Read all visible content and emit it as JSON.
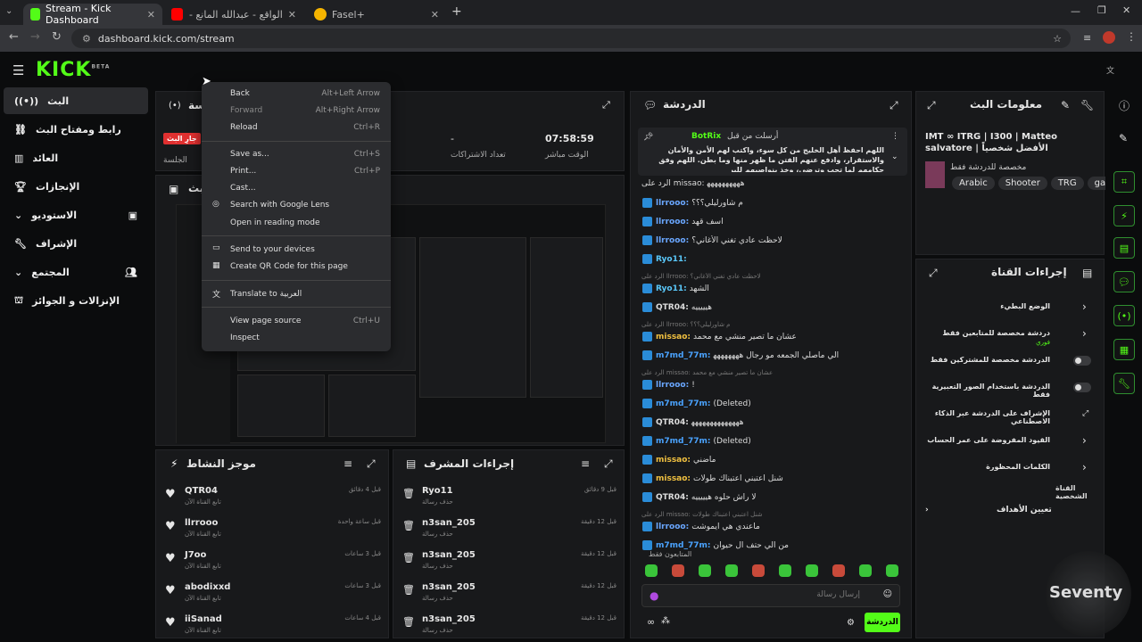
{
  "browser": {
    "tabs": [
      {
        "label": "Stream - Kick Dashboard"
      },
      {
        "label": "الواقع - عبدالله المانع - YouTube"
      },
      {
        "label": "Fasel+"
      }
    ],
    "url": "dashboard.kick.com/stream"
  },
  "sidebar": {
    "items": [
      {
        "label": "البث"
      },
      {
        "label": "رابط ومفتاح البث"
      },
      {
        "label": "العائد"
      },
      {
        "label": "الإنجازات"
      },
      {
        "label": "الاستوديو"
      },
      {
        "label": "الإشراف"
      },
      {
        "label": "المجتمع"
      },
      {
        "label": "الإنزالات و الجوائز"
      }
    ],
    "logo": "KICK",
    "logo_sup": "BETA"
  },
  "session": {
    "title": "الجلسة",
    "live_badge": "جارِ البث",
    "session_label": "الجلسة",
    "subs_value": "-",
    "subs_label": "تعداد الاشتراكات",
    "time_value": "07:58:59",
    "time_label": "الوقت مباشر",
    "preview_title": "بث"
  },
  "context_menu": {
    "items": [
      {
        "label": "Back",
        "key": "Alt+Left Arrow"
      },
      {
        "label": "Forward",
        "key": "Alt+Right Arrow"
      },
      {
        "label": "Reload",
        "key": "Ctrl+R"
      },
      {
        "label": "Save as...",
        "key": "Ctrl+S"
      },
      {
        "label": "Print...",
        "key": "Ctrl+P"
      },
      {
        "label": "Cast...",
        "key": ""
      },
      {
        "label": "Search with Google Lens",
        "key": ""
      },
      {
        "label": "Open in reading mode",
        "key": ""
      },
      {
        "label": "Send to your devices",
        "key": ""
      },
      {
        "label": "Create QR Code for this page",
        "key": ""
      },
      {
        "label": "Translate to العربية",
        "key": ""
      },
      {
        "label": "View page source",
        "key": "Ctrl+U"
      },
      {
        "label": "Inspect",
        "key": ""
      }
    ]
  },
  "chat": {
    "title": "الدردشة",
    "pinned_by": "أرسلت من قبل",
    "pinned_user": "BotRix",
    "pinned_text": "اللهم احفظ أهل الخليج من كل سوء، واكتب لهم الأمن والأمان والاستقرار، وادفع عنهم الفتن ما ظهر منها وما بطن. اللهم وفق حكامهم لما تحب وترضى، وخذ بنواصيهم للبر",
    "messages": [
      {
        "user": "",
        "text": "الرد على missao: ﻫﻬﻬﻬﻬﻬﻬﻬﻬﻬ",
        "reply": ""
      },
      {
        "user": "llrrooo",
        "text": "م شاورليلي؟؟؟",
        "reply": ""
      },
      {
        "user": "llrrooo",
        "text": "اسف قهد",
        "reply": ""
      },
      {
        "user": "llrrooo",
        "text": "لاحظت عادي تغني الأغاني؟",
        "reply": ""
      },
      {
        "user": "Ryo11",
        "text": "",
        "reply": ""
      },
      {
        "user": "Ryo11",
        "text": "الشهد",
        "reply": "الرد على llrrooo: لاحظت عادي تغني الأغاني؟"
      },
      {
        "user": "QTR04",
        "text": "هيييييه",
        "reply": ""
      },
      {
        "user": "missao",
        "text": "عشان ما تصير منشي مع محمد",
        "reply": "الرد على llrrooo: م شاورليلي؟؟؟"
      },
      {
        "user": "m7md_77m",
        "text": "الي ماصلي الجمعه مو رجال ﻫﻬﻬﻬﻬﻬﻬﻬ",
        "reply": ""
      },
      {
        "user": "llrrooo",
        "text": "!",
        "reply": "الرد على missao: عشان ما تصير منشي مع محمد"
      },
      {
        "user": "m7md_77m",
        "text": "(Deleted)",
        "reply": ""
      },
      {
        "user": "QTR04",
        "text": "ﻫﻬﻬﻬﻬﻬﻬﻬﻬﻬﻬﻬﻬﻬ",
        "reply": ""
      },
      {
        "user": "m7md_77m",
        "text": "(Deleted)",
        "reply": ""
      },
      {
        "user": "missao",
        "text": "ماضني",
        "reply": ""
      },
      {
        "user": "missao",
        "text": "شنل اعتبني اعتبناك طولات",
        "reply": ""
      },
      {
        "user": "QTR04",
        "text": "لا راش حلوه هيييييه",
        "reply": ""
      },
      {
        "user": "llrrooo",
        "text": "ماعندي هي ايموشت",
        "reply": "الرد على missao: شنل اعتبني اعتبناك طولات"
      },
      {
        "user": "m7md_77m",
        "text": "من الي حتف ال حيوان",
        "reply": ""
      }
    ],
    "followers_only": "المتابعون فقط",
    "input_placeholder": "إرسال رسالة",
    "send_label": "الدردشة"
  },
  "stream_info": {
    "title": "معلومات البث",
    "stream_title": "IMT ∞ ITRG | I300 | Matteo salvatore | الأفضل شخصياً",
    "category": "مخصصة للدردشة فقط",
    "tags": [
      "Arabic",
      "Shooter",
      "TRG",
      "gamin"
    ]
  },
  "channel_actions": {
    "title": "إجراءات القناة",
    "items": [
      {
        "label": "الوضع البطيء",
        "sub": ""
      },
      {
        "label": "دردشة مخصصة للمتابعين فقط",
        "sub": "فوري"
      },
      {
        "label": "الدردشة مخصصة للمشتركين فقط",
        "sub": ""
      },
      {
        "label": "الدردشة باستخدام الصور التعبيرية فقط",
        "sub": ""
      },
      {
        "label": "الإشراف على الدردشة عبر الذكاء الاصطناعي",
        "sub": ""
      },
      {
        "label": "القيود المفروضة على عمر الحساب",
        "sub": ""
      },
      {
        "label": "الكلمات المحظورة",
        "sub": ""
      }
    ],
    "section": "القناة الشخصية",
    "goals": "تعيين الأهداف"
  },
  "activity": {
    "title": "موجز النشاط",
    "items": [
      {
        "user": "QTR04",
        "action": "تابع القناة الآن",
        "time": "قبل 4 دقائق"
      },
      {
        "user": "llrrooo",
        "action": "تابع القناة الآن",
        "time": "قبل ساعة واحدة"
      },
      {
        "user": "J7oo",
        "action": "تابع القناة الآن",
        "time": "قبل 3 ساعات"
      },
      {
        "user": "abodixxd",
        "action": "تابع القناة الآن",
        "time": "قبل 3 ساعات"
      },
      {
        "user": "iiSanad",
        "action": "تابع القناة الآن",
        "time": "قبل 4 ساعات"
      }
    ]
  },
  "mod_actions": {
    "title": "إجراءات المشرف",
    "items": [
      {
        "user": "Ryo11",
        "action": "حذف رسالة",
        "time": "قبل 9 دقائق"
      },
      {
        "user": "n3san_205",
        "action": "حذف رسالة",
        "time": "قبل 12 دقيقة"
      },
      {
        "user": "n3san_205",
        "action": "حذف رسالة",
        "time": "قبل 12 دقيقة"
      },
      {
        "user": "n3san_205",
        "action": "حذف رسالة",
        "time": "قبل 12 دقيقة"
      },
      {
        "user": "n3san_205",
        "action": "حذف رسالة",
        "time": "قبل 12 دقيقة"
      }
    ]
  },
  "watermark": "Seventy",
  "colors": {
    "accent": "#53fc18"
  }
}
